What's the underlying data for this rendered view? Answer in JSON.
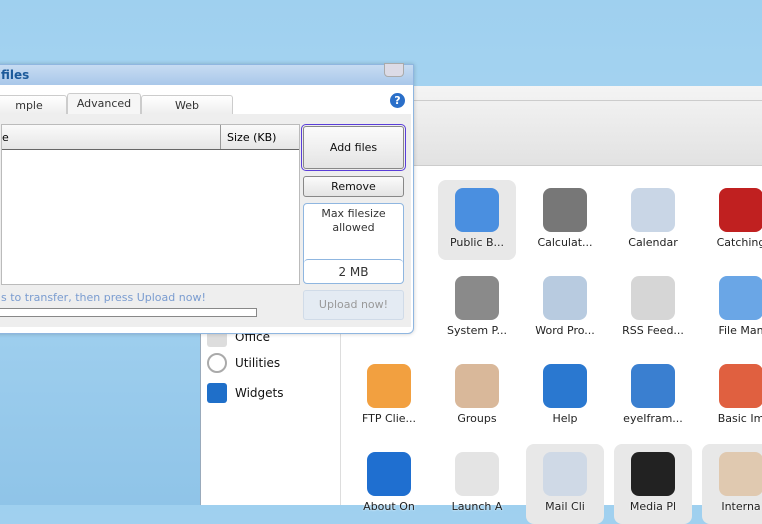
{
  "dialog": {
    "title": "files",
    "tabs": [
      "mple",
      "Advanced",
      "Web"
    ],
    "active_tab": "Advanced",
    "columns": [
      "e",
      "Size (KB)"
    ],
    "add_files": "Add files",
    "remove": "Remove",
    "max_label": "Max filesize allowed",
    "max_value": "2 MB",
    "upload": "Upload now!",
    "hint": "s to transfer, then press Upload now!",
    "progress": 0
  },
  "sidebar": {
    "items": [
      "Office",
      "Utilities",
      "Widgets"
    ]
  },
  "apps": [
    {
      "label": "Public B...",
      "color": "#4a8fe0",
      "selected": true
    },
    {
      "label": "Calculat...",
      "color": "#777777"
    },
    {
      "label": "Calendar",
      "color": "#c9d6e6"
    },
    {
      "label": "Catching",
      "color": "#c02020"
    },
    {
      "label": "System P...",
      "color": "#8a8a8a"
    },
    {
      "label": "Word Pro...",
      "color": "#b8cbe0"
    },
    {
      "label": "RSS Feed...",
      "color": "#d6d6d6"
    },
    {
      "label": "File Man",
      "color": "#6aa6e6"
    },
    {
      "label": "FTP Clie...",
      "color": "#f2a040"
    },
    {
      "label": "Groups",
      "color": "#d9b89a"
    },
    {
      "label": "Help",
      "color": "#2a78d0"
    },
    {
      "label": "eyeIfram...",
      "color": "#3a7fd0"
    },
    {
      "label": "Basic Im",
      "color": "#e06040"
    },
    {
      "label": "About On",
      "color": "#1f6fd0"
    },
    {
      "label": "Launch A",
      "color": "#e4e4e4"
    },
    {
      "label": "Mail Cli",
      "color": "#cfd9e6",
      "selected": true
    },
    {
      "label": "Media Pl",
      "color": "#222222",
      "selected": true
    },
    {
      "label": "Interna",
      "color": "#e0c9b0",
      "selected": true
    }
  ]
}
